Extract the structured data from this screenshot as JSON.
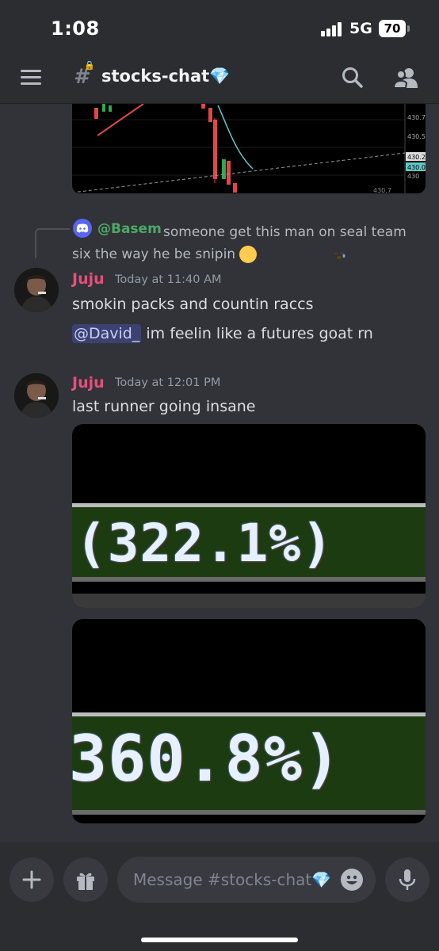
{
  "status_bar": {
    "time": "1:08",
    "network": "5G",
    "battery": "70"
  },
  "header": {
    "channel_name": "stocks-chat💎",
    "channel_type_icon": "hashtag-lock-icon"
  },
  "chart_crop": {
    "ticks": [
      "430.7",
      "430.5",
      "430.2",
      "430.0",
      "430",
      "430.7"
    ]
  },
  "reply": {
    "author": "@Basem",
    "text": "someone get this man on seal team six the way he be snipin",
    "emoji": "sleepy-face-emoji"
  },
  "messages": [
    {
      "author": "Juju",
      "timestamp": "Today at 11:40 AM",
      "lines": [
        "smokin packs and countin raccs"
      ],
      "mention_line": {
        "mention": "@David_",
        "text": " im feelin like a futures goat rn"
      }
    },
    {
      "author": "Juju",
      "timestamp": "Today at 12:01 PM",
      "lines": [
        "last runner going insane"
      ],
      "attachments": [
        {
          "value": "(322.1%)"
        },
        {
          "value": "360.8%)"
        }
      ]
    }
  ],
  "composer": {
    "placeholder": "Message #stocks-chat💎"
  },
  "colors": {
    "background": "#313338",
    "header": "#2b2d31",
    "author": "#e7507a",
    "reply_author": "#4ea867",
    "mention_bg": "#3c4270"
  }
}
